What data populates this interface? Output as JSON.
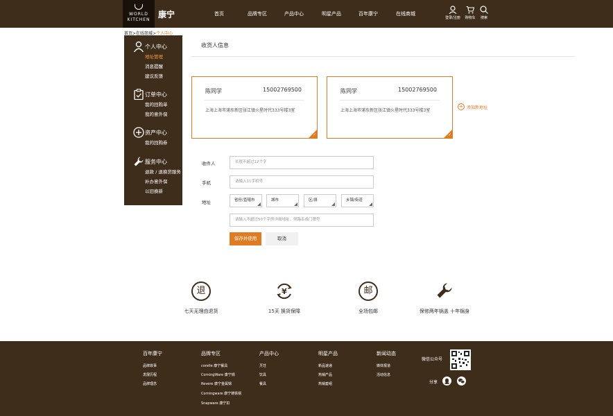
{
  "header": {
    "logo_line1": "WORLD",
    "logo_line2": "KITCHEN",
    "brand": "康宁",
    "nav": [
      "首页",
      "品牌专区",
      "产品中心",
      "明星产品",
      "百年康宁",
      "在线商城"
    ],
    "login_label": "登录/注册",
    "cart_label": "购物车",
    "search_label": "搜索"
  },
  "breadcrumb": {
    "home": "首页",
    "sep1": ">",
    "store": "在线商城",
    "sep2": ">",
    "current": "个人中心"
  },
  "sidebar": {
    "sections": [
      {
        "title": "个人中心",
        "icon": "user-icon",
        "items": [
          "地址管理",
          "消息提醒",
          "建议反馈"
        ],
        "active_item": "地址管理"
      },
      {
        "title": "订单中心",
        "icon": "clipboard-icon",
        "items": [
          "我的回购单",
          "我的意外保"
        ]
      },
      {
        "title": "资产中心",
        "icon": "plus-circle-icon",
        "items": [
          "我的回购券"
        ]
      },
      {
        "title": "服务中心",
        "icon": "wrench-icon",
        "items": [
          "退款 / 退换货服务",
          "补办意外保",
          "以旧换新"
        ]
      }
    ]
  },
  "main": {
    "title": "收货人信息",
    "addresses": [
      {
        "name": "陈同学",
        "phone": "15002769500",
        "address": "上海上海市浦东新区张江镇火星时代333号楼3室"
      },
      {
        "name": "陈同学",
        "phone": "15002769500",
        "address": "上海上海市浦东新区张江镇火星时代333号楼3室"
      }
    ],
    "add_new_label": "添加新地址",
    "form": {
      "recipient_label": "收件人",
      "recipient_placeholder": "长度不超过12个字",
      "phone_label": "手机",
      "phone_placeholder": "请输入11手机号",
      "address_label": "地址",
      "province": "省份/直辖市",
      "city": "城市",
      "district": "区/县",
      "town": "乡镇/街道",
      "detail_placeholder": "请输入不超过50个字的详细地址，例路名或门牌号",
      "save_label": "保存并使用",
      "cancel_label": "取消"
    }
  },
  "services": [
    {
      "icon_glyph": "退",
      "icon": "return-icon",
      "label": "七天无理由退货"
    },
    {
      "icon_glyph": "¥",
      "icon": "yuan-exchange-icon",
      "label": "15天 换货保障"
    },
    {
      "icon_glyph": "邮",
      "icon": "shipping-icon",
      "label": "全场包邮"
    },
    {
      "icon_glyph": "🔧",
      "icon": "wrench-icon",
      "label": "保修两年锅盖 十年锅身"
    }
  ],
  "footer": {
    "columns": [
      {
        "title": "百年康宁",
        "items": [
          "品牌故事",
          "发展历程",
          "品牌理念"
        ]
      },
      {
        "title": "品牌专区",
        "items": [
          "corelle 康宁餐具",
          "CorningWare 康宁锅",
          "Revere 康宁金属锅",
          "Corningware 康宁铸铁锅",
          "Snapware 康宁扣"
        ]
      },
      {
        "title": "产品中心",
        "items": [
          "烹饪",
          "饮具",
          "餐具"
        ]
      },
      {
        "title": "明星产品",
        "items": [
          "新品速递",
          "热销产品",
          "热销套组"
        ]
      },
      {
        "title": "新闻动态",
        "items": [
          "媒体报道",
          "活动信息"
        ]
      }
    ],
    "wechat_label": "微信公众号",
    "share_label": "分享"
  },
  "colors": {
    "brown": "#3f2d1c",
    "accent": "#e07b22"
  }
}
